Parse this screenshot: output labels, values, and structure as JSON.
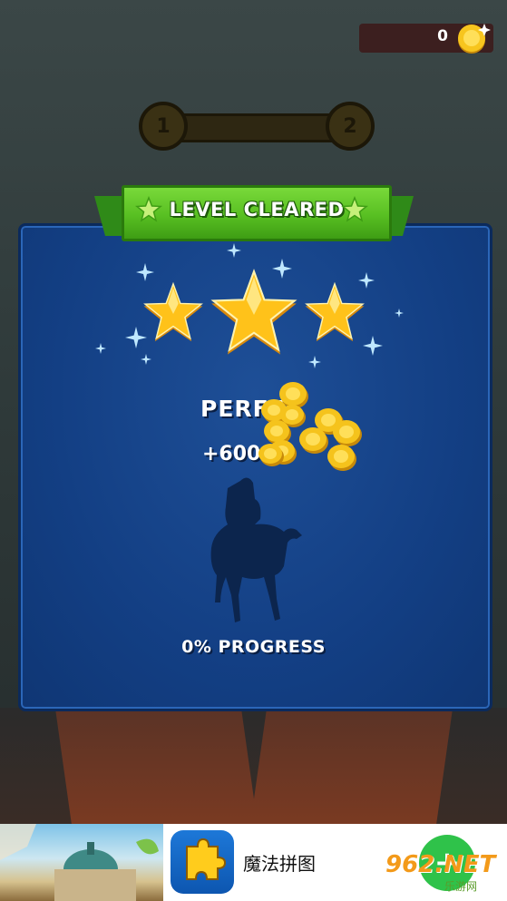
{
  "hud": {
    "coin_count": "0",
    "coin_icon": "coin-icon"
  },
  "level_progress": {
    "current_level": "1",
    "next_level": "2"
  },
  "result_panel": {
    "title": "LEVEL CLEARED",
    "stars_earned": 3,
    "stars_total": 3,
    "rating_text": "PERFE",
    "reward_text": "+600",
    "progress_text": "0% PROGRESS",
    "progress_value": 0
  },
  "ad": {
    "app_name": "魔法拼图",
    "install_icon": "plus-icon"
  },
  "watermark": {
    "text": "962.NET",
    "sub": "乐游网"
  },
  "colors": {
    "panel_blue": "#133f84",
    "ribbon_green": "#58bf22",
    "star_gold": "#ffc21a",
    "coin_gold": "#f5c31c"
  }
}
